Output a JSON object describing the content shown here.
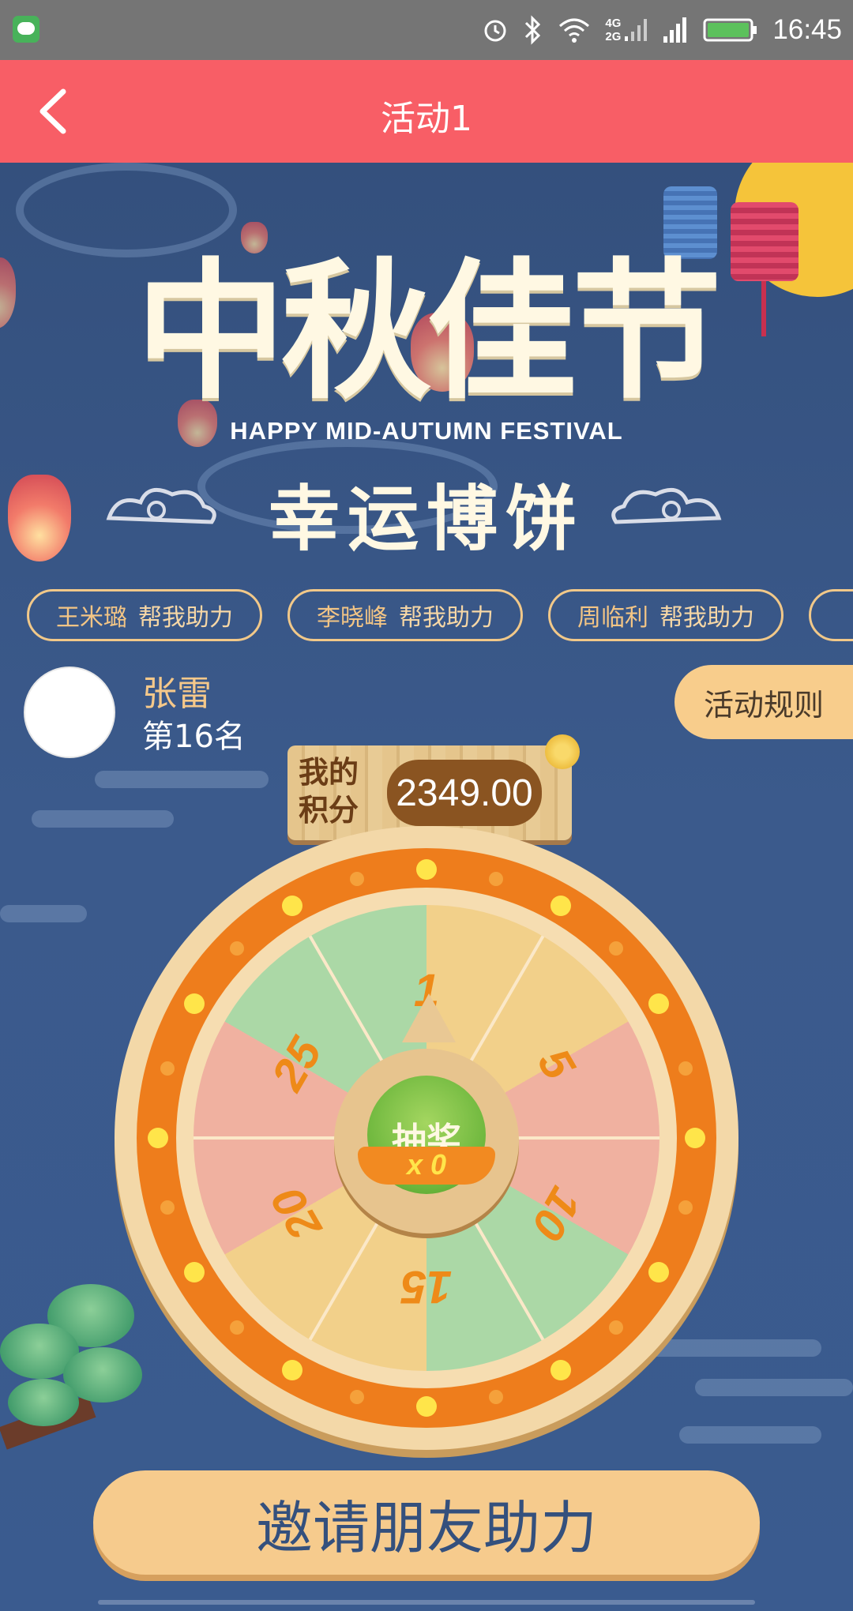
{
  "status_bar": {
    "time": "16:45",
    "icons": [
      "chat-app-icon",
      "alarm-icon",
      "bluetooth-icon",
      "wifi-icon",
      "signal-4g-2g-icon",
      "signal-icon",
      "battery-icon"
    ],
    "network_top": "4G",
    "network_bottom": "2G"
  },
  "header": {
    "title": "活动1",
    "background": "#f85e66"
  },
  "banner": {
    "title": "中秋佳节",
    "subtitle_en": "HAPPY MID-AUTUMN FESTIVAL",
    "subtitle_cn": "幸运博饼"
  },
  "helpers": [
    {
      "name": "王米璐",
      "action": "帮我助力"
    },
    {
      "name": "李晓峰",
      "action": "帮我助力"
    },
    {
      "name": "周临利",
      "action": "帮我助力"
    }
  ],
  "user": {
    "name": "张雷",
    "rank": "第16名"
  },
  "rules_button": "活动规则",
  "score": {
    "label_line1": "我的",
    "label_line2": "积分",
    "value": "2349.00"
  },
  "wheel": {
    "prizes": [
      "1",
      "5",
      "10",
      "15",
      "20",
      "25"
    ],
    "spin_label": "抽奖",
    "spin_count": "x 0",
    "colors": {
      "yellow": "#f2d08a",
      "pink": "#f0b1a0",
      "green": "#abd8a6",
      "ring": "#ee7d1c"
    }
  },
  "invite_button": "邀请朋友助力",
  "colors": {
    "accent": "#f85e66",
    "background": "#3a5585",
    "gold": "#f6cb8d"
  }
}
